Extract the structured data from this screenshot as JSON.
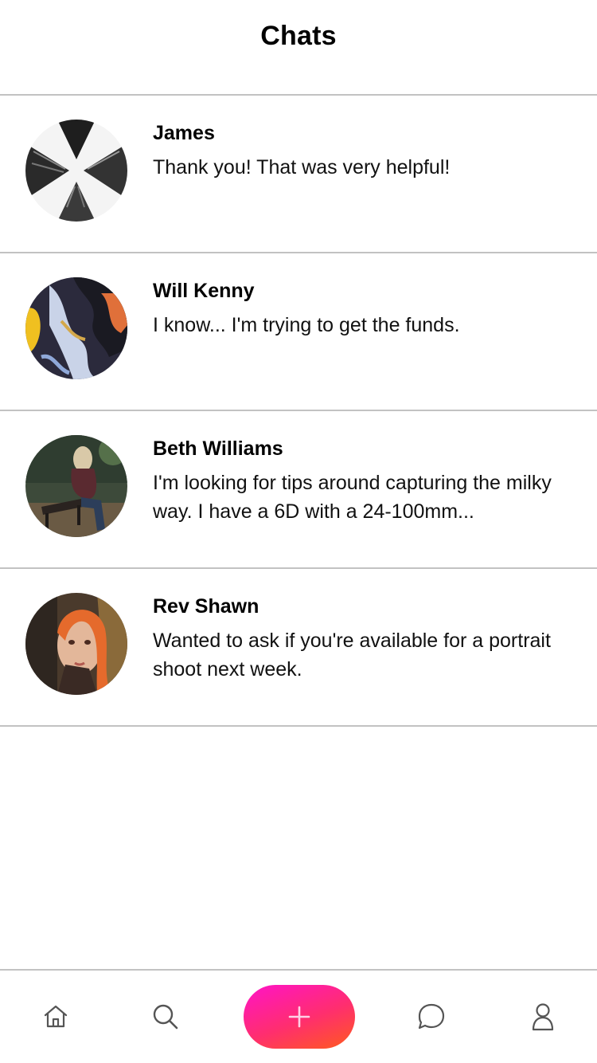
{
  "header": {
    "title": "Chats"
  },
  "chats": [
    {
      "name": "James",
      "message": "Thank you! That was very helpful!"
    },
    {
      "name": "Will Kenny",
      "message": "I know... I'm trying to get the funds."
    },
    {
      "name": "Beth Williams",
      "message": "I'm looking for tips around capturing the milky way. I have a 6D with a 24-100mm..."
    },
    {
      "name": "Rev Shawn",
      "message": "Wanted to ask if you're available for a portrait shoot next week."
    }
  ],
  "bottom_nav": {
    "items": [
      {
        "icon": "home-icon"
      },
      {
        "icon": "search-icon"
      },
      {
        "icon": "plus-icon"
      },
      {
        "icon": "chat-bubble-icon"
      },
      {
        "icon": "user-icon"
      }
    ]
  },
  "colors": {
    "divider": "#c2c2c2",
    "accent_gradient_start": "#ff13c8",
    "accent_gradient_end": "#ff5a1e",
    "icon": "#555555"
  }
}
